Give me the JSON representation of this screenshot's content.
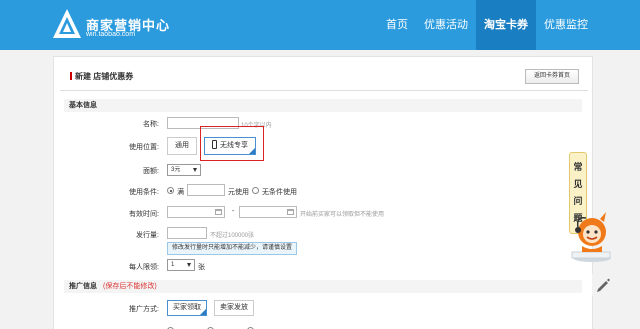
{
  "header": {
    "logo_cn": "商家营销中心",
    "logo_en": "win.taobao.com",
    "nav": [
      {
        "label": "首页",
        "active": false
      },
      {
        "label": "优惠活动",
        "active": false
      },
      {
        "label": "淘宝卡券",
        "active": true
      },
      {
        "label": "优惠监控",
        "active": false
      }
    ]
  },
  "panel": {
    "title": "新建 店铺优惠券",
    "return_label": "返回卡券首页"
  },
  "basic": {
    "section_title": "基本信息",
    "name_label": "名称:",
    "name_hint": "10个字以内",
    "position_label": "使用位置:",
    "position_general": "通用",
    "position_wireless": "无线专享",
    "denom_label": "面额:",
    "denom_value": "3元",
    "condition_label": "使用条件:",
    "condition_full": "满",
    "condition_unit": "元使用",
    "condition_none": "无条件使用",
    "valid_label": "有效时间:",
    "valid_sep": "-",
    "valid_hint": "开始前买家可以领取但不能使用",
    "issue_label": "发行量:",
    "issue_hint": "不超过100000张",
    "issue_tip": "修改发行量时只能增加不能减少，请谨慎设置",
    "limit_label": "每人限领:",
    "limit_value": "1",
    "limit_unit": "张"
  },
  "promo": {
    "section_title": "推广信息",
    "section_warn": "(保存后不能修改)",
    "method_label": "推广方式:",
    "method_buyer": "买家领取",
    "method_seller": "卖家发放"
  },
  "faq": {
    "label_chars": [
      "常",
      "见",
      "问",
      "题"
    ]
  },
  "icons": [
    "logo-icon",
    "phone-icon",
    "calendar-icon",
    "chevron-down-icon",
    "mascot-icon",
    "edit-icon"
  ],
  "colors": {
    "header": "#2b9bde",
    "nav_active": "#1a7fc2",
    "highlight_box": "#dd2222",
    "selected_corner": "#2b7cc4"
  }
}
